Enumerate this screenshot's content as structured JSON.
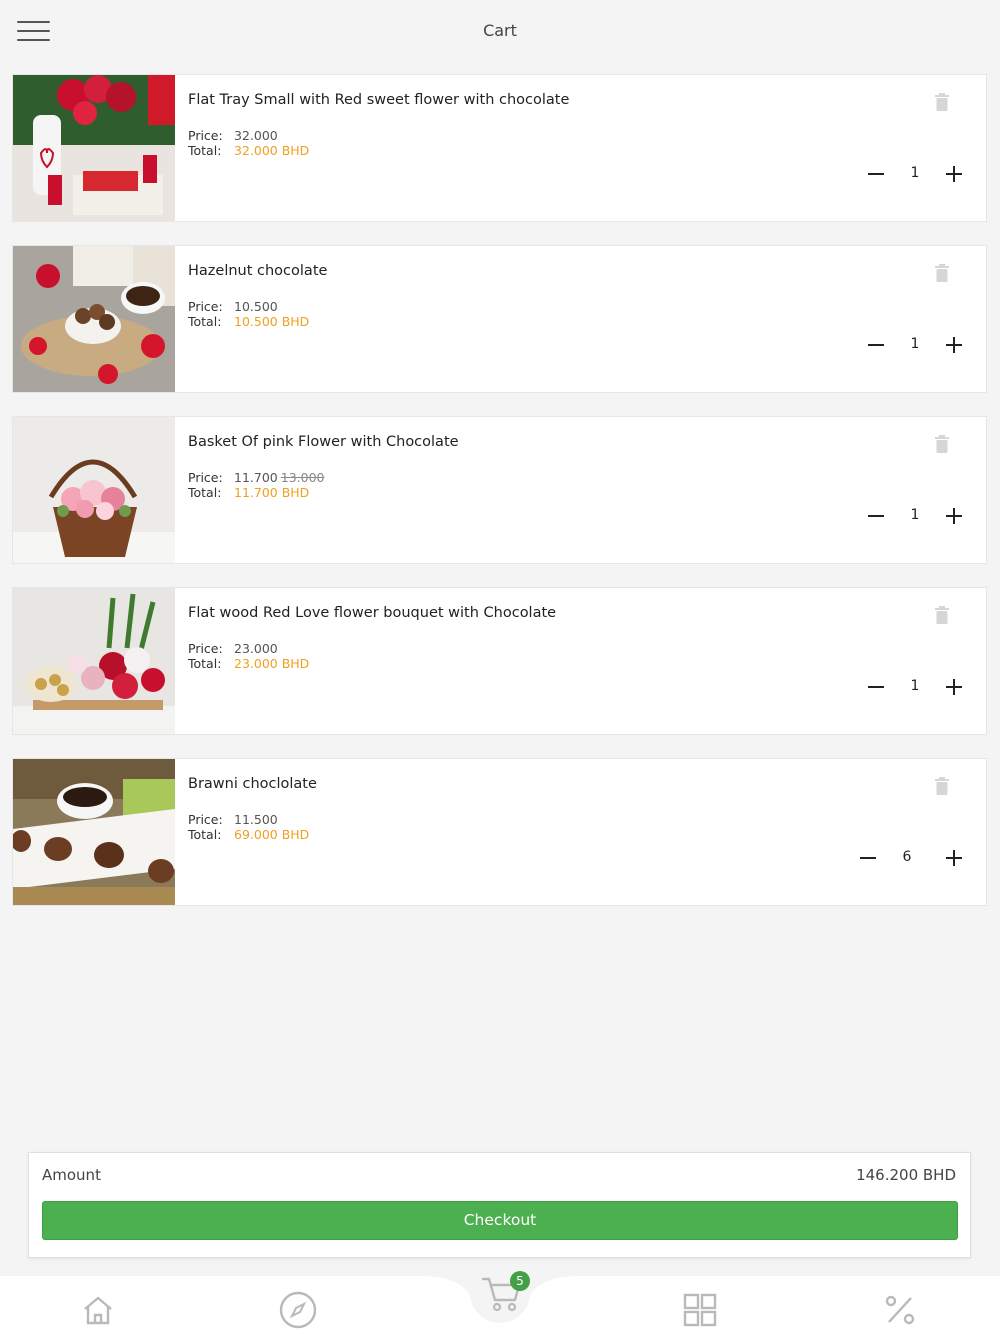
{
  "header": {
    "title": "Cart",
    "menu_icon": "hamburger-menu-icon"
  },
  "cart": {
    "price_label": "Price:",
    "total_label": "Total:",
    "items": [
      {
        "name": "Flat Tray Small  with Red sweet flower with chocolate",
        "price": "32.000",
        "old_price": "",
        "total": "32.000 BHD",
        "quantity": "1"
      },
      {
        "name": "Hazelnut chocolate",
        "price": "10.500",
        "old_price": "",
        "total": "10.500 BHD",
        "quantity": "1"
      },
      {
        "name": "Basket Of pink Flower with Chocolate",
        "price": "11.700",
        "old_price": "13.000",
        "total": "11.700 BHD",
        "quantity": "1"
      },
      {
        "name": "Flat wood Red Love flower bouquet with Chocolate",
        "price": "23.000",
        "old_price": "",
        "total": "23.000 BHD",
        "quantity": "1"
      },
      {
        "name": "Brawni choclolate",
        "price": "11.500",
        "old_price": "",
        "total": "69.000 BHD",
        "quantity": "6"
      }
    ]
  },
  "summary": {
    "amount_label": "Amount",
    "amount_value": "146.200 BHD",
    "checkout_label": "Checkout"
  },
  "tabbar": {
    "cart_badge": "5",
    "tabs": [
      "home-icon",
      "compass-icon",
      "cart-icon",
      "grid-icon",
      "percent-icon"
    ]
  },
  "colors": {
    "accent_green": "#4caf50",
    "total_orange": "#f0a020",
    "background": "#f4f4f4"
  }
}
